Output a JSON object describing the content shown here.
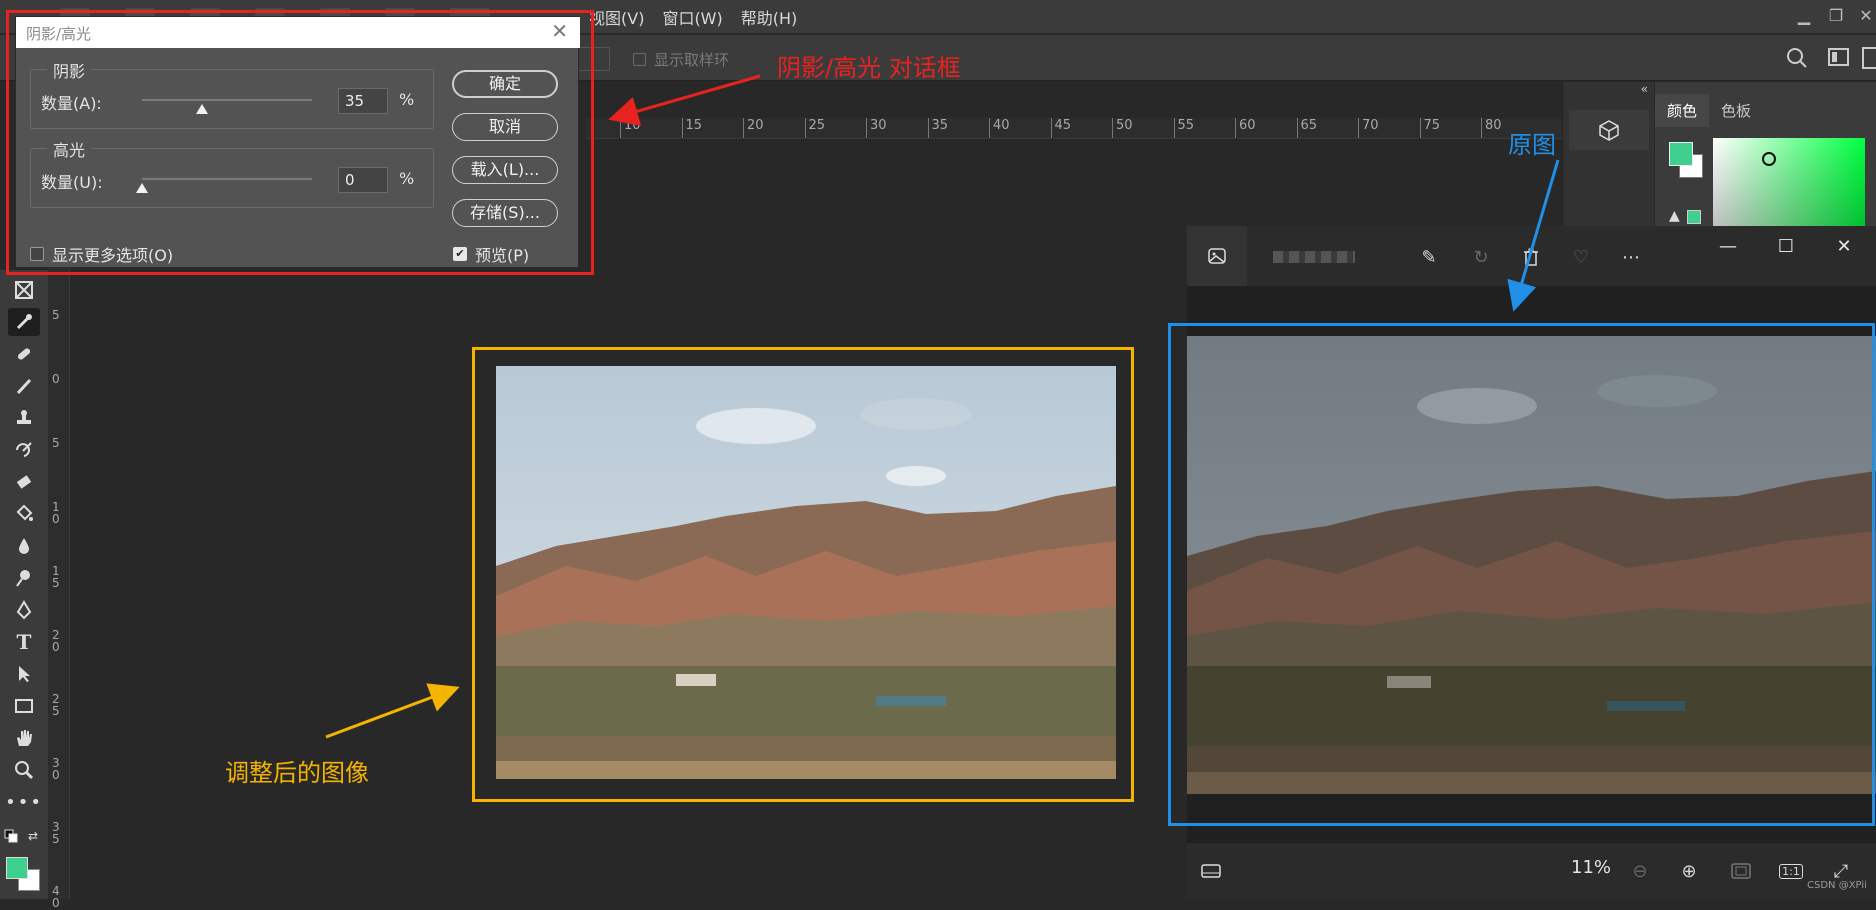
{
  "menubar": {
    "items": [
      "视图(V)",
      "窗口(W)",
      "帮助(H)"
    ]
  },
  "optionsbar": {
    "sample_ring_label": "显示取样环"
  },
  "ruler": {
    "top_ticks": [
      "10",
      "15",
      "20",
      "25",
      "30",
      "35",
      "40",
      "45",
      "50",
      "55",
      "60",
      "65",
      "70",
      "75",
      "80"
    ],
    "left_ticks": [
      "5",
      "0",
      "5",
      "10",
      "15",
      "20",
      "25",
      "30",
      "35",
      "40"
    ]
  },
  "dialog": {
    "title": "阴影/高光",
    "shadows": {
      "legend": "阴影",
      "amount_label": "数量(A):",
      "value": "35",
      "unit": "%",
      "slider_value": 35
    },
    "highlights": {
      "legend": "高光",
      "amount_label": "数量(U):",
      "value": "0",
      "unit": "%",
      "slider_value": 0
    },
    "buttons": {
      "ok": "确定",
      "cancel": "取消",
      "load": "载入(L)...",
      "save": "存储(S)..."
    },
    "more_options_label": "显示更多选项(O)",
    "more_options_checked": false,
    "preview_label": "预览(P)",
    "preview_checked": true
  },
  "right_panel": {
    "tabs": [
      "颜色",
      "色板"
    ],
    "active_tab": "颜色",
    "foreground_color": "#3fcf8e",
    "background_color": "#ffffff"
  },
  "viewer": {
    "zoom": "11%",
    "actual_size_label": "1:1",
    "watermark": "CSDN @XPii"
  },
  "annotations": {
    "dialog_label": "阴影/高光 对话框",
    "original_label": "原图",
    "adjusted_label": "调整后的图像",
    "colors": {
      "red": "#e8231f",
      "blue": "#1f8fe8",
      "yellow": "#f5b400"
    }
  }
}
